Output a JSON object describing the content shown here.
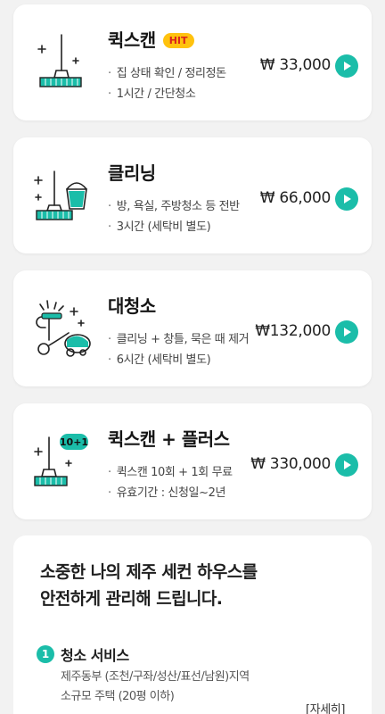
{
  "services": [
    {
      "title": "퀵스캔",
      "badge": "HIT",
      "desc": [
        "집 상태 확인 / 정리정돈",
        "1시간 / 간단청소"
      ],
      "price": "₩ 33,000",
      "icon": "broom-icon"
    },
    {
      "title": "클리닝",
      "desc": [
        "방, 욕실, 주방청소 등 전반",
        "3시간 (세탁비 별도)"
      ],
      "price": "₩ 66,000",
      "icon": "broom-bucket-icon"
    },
    {
      "title": "대청소",
      "desc": [
        "클리닝 + 창틀, 묵은 때 제거",
        "6시간 (세탁비 별도)"
      ],
      "price": "₩132,000",
      "icon": "vacuum-icon"
    },
    {
      "title": "퀵스캔 + 플러스",
      "desc": [
        "퀵스캔 10회 + 1회 무료",
        "유효기간 : 신청일~2년"
      ],
      "price": "₩ 330,000",
      "icon": "broom-10plus1-icon",
      "icon_badge": "10+1"
    }
  ],
  "info": {
    "headline_line1": "소중한 나의 제주 세컨 하우스를",
    "headline_line2": "안전하게 관리해 드립니다.",
    "section_number": "1",
    "section_title": "청소 서비스",
    "section_desc_line1": "제주동부 (조천/구좌/성산/표선/남원)지역",
    "section_desc_line2": "소규모 주택 (20평 이하)",
    "more_label": "[자세히]"
  },
  "colors": {
    "accent": "#1bbda9",
    "badge_bg": "#ffc20e",
    "badge_text": "#d9231b",
    "background": "#f2f2f2"
  }
}
